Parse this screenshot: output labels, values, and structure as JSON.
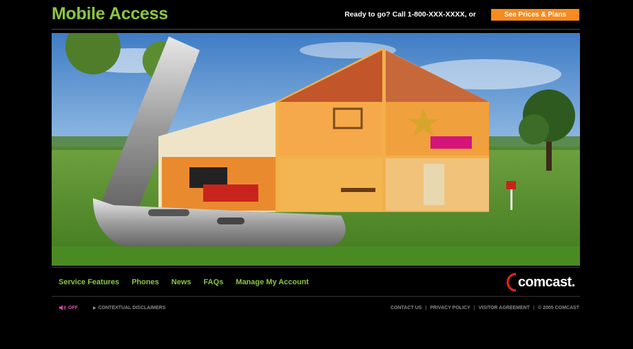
{
  "header": {
    "title": "Mobile Access",
    "cta_text": "Ready to go? Call 1-800-XXX-XXXX, or",
    "prices_button": "See Prices & Plans"
  },
  "nav": {
    "items": [
      {
        "label": "Service Features"
      },
      {
        "label": "Phones"
      },
      {
        "label": "News"
      },
      {
        "label": "FAQs"
      },
      {
        "label": "Manage My Account"
      }
    ]
  },
  "brand": {
    "logo_text": "comcast."
  },
  "footer": {
    "sound_label": "OFF",
    "disclaimer_label": "CONTEXTUAL DISCLAIMERS",
    "links": [
      {
        "label": "CONTACT US"
      },
      {
        "label": "PRIVACY POLICY"
      },
      {
        "label": "VISITOR AGREEMENT"
      },
      {
        "label": "© 2005 COMCAST"
      }
    ],
    "separator": "|"
  },
  "colors": {
    "accent_green": "#8cc63f",
    "button_orange": "#f68b1f",
    "sound_pink": "#e04bb0",
    "logo_red": "#e2231a"
  },
  "icons": {
    "sound": "speaker-icon",
    "disclaimer": "triangle-right-icon"
  }
}
